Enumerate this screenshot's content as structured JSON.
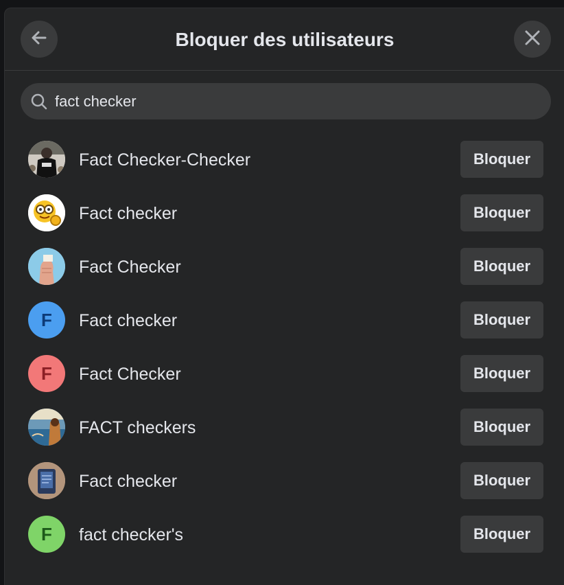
{
  "dialog": {
    "title": "Bloquer des utilisateurs",
    "back_icon": "arrow-left-icon",
    "close_icon": "close-icon"
  },
  "search": {
    "icon": "search-icon",
    "value": "fact checker"
  },
  "results": [
    {
      "name": "Fact Checker-Checker",
      "avatar": "photo",
      "button": "Bloquer"
    },
    {
      "name": "Fact checker",
      "avatar": "emoji-magnifier",
      "button": "Bloquer"
    },
    {
      "name": "Fact Checker",
      "avatar": "photo",
      "button": "Bloquer"
    },
    {
      "name": "Fact checker",
      "avatar_letter": "F",
      "avatar_bg": "#4b9ef0",
      "avatar_fg": "#0d3b78",
      "button": "Bloquer"
    },
    {
      "name": "Fact Checker",
      "avatar_letter": "F",
      "avatar_bg": "#f27878",
      "avatar_fg": "#8c1f25",
      "button": "Bloquer"
    },
    {
      "name": "FACT checkers",
      "avatar": "photo",
      "button": "Bloquer"
    },
    {
      "name": "Fact checker",
      "avatar": "photo",
      "button": "Bloquer"
    },
    {
      "name": "fact checker's",
      "avatar_letter": "F",
      "avatar_bg": "#7fd468",
      "avatar_fg": "#1d5a1a",
      "button": "Bloquer"
    }
  ]
}
